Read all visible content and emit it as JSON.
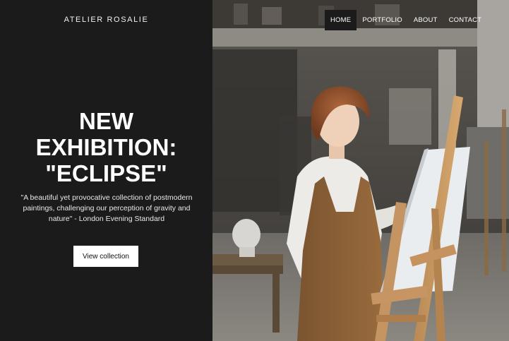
{
  "brand": {
    "name": "ATELIER ROSALIE"
  },
  "nav": {
    "items": [
      {
        "label": "HOME",
        "active": true
      },
      {
        "label": "PORTFOLIO",
        "active": false
      },
      {
        "label": "ABOUT",
        "active": false
      },
      {
        "label": "CONTACT",
        "active": false
      }
    ]
  },
  "hero": {
    "title_lines": [
      "NEW",
      "EXHIBITION:",
      "\"ECLIPSE\""
    ],
    "quote": "\"A beautiful yet provocative collection of postmodern paintings, challenging our perception of gravity and nature\" - London Evening Standard",
    "button_label": "View collection"
  },
  "colors": {
    "panel_background": "#1b1b1c",
    "text_light": "#ffffff",
    "button_background": "#ffffff"
  }
}
